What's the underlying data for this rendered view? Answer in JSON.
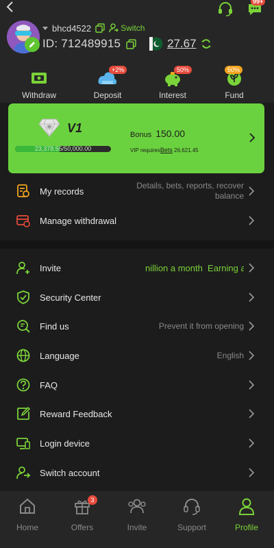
{
  "header": {
    "username": "bhcd4522",
    "switch_label": "Switch",
    "id_label": "ID: 712489915",
    "balance": "27.67",
    "notification_badge": "99+"
  },
  "actions": [
    {
      "label": "Withdraw",
      "badge": ""
    },
    {
      "label": "Deposit",
      "badge": "+2%"
    },
    {
      "label": "Interest",
      "badge": "50%"
    },
    {
      "label": "Fund",
      "badge": "50%"
    }
  ],
  "vip": {
    "level": "V1",
    "bonus_label": "Bonus",
    "bonus_value": "150.00",
    "progress_text": "23,378.55/50,000.00",
    "progress_fraction": 0.4676,
    "requires_label": "VIP requires",
    "requires_link": "Bets",
    "requires_value": "26,621.45"
  },
  "menu_top": [
    {
      "label": "My records",
      "value": "Details, bets, reports, recover balance"
    },
    {
      "label": "Manage withdrawal",
      "value": ""
    }
  ],
  "menu_bottom": [
    {
      "label": "Invite",
      "value": "nillion a month  Earning a"
    },
    {
      "label": "Security Center",
      "value": ""
    },
    {
      "label": "Find us",
      "value": "Prevent it from opening"
    },
    {
      "label": "Language",
      "value": "English"
    },
    {
      "label": "FAQ",
      "value": ""
    },
    {
      "label": "Reward Feedback",
      "value": ""
    },
    {
      "label": "Login device",
      "value": ""
    },
    {
      "label": "Switch account",
      "value": ""
    }
  ],
  "nav": [
    {
      "label": "Home",
      "badge": ""
    },
    {
      "label": "Offers",
      "badge": "3"
    },
    {
      "label": "Invite",
      "badge": ""
    },
    {
      "label": "Support",
      "badge": ""
    },
    {
      "label": "Profile",
      "badge": ""
    }
  ],
  "colors": {
    "accent": "#6bd23f",
    "badge": "#e64b3c",
    "background": "#1c1c1c"
  },
  "icons": [
    "back-icon",
    "headset-icon",
    "chat-icon",
    "copy-icon",
    "flag-icon",
    "refresh-icon",
    "withdraw-icon",
    "deposit-icon",
    "interest-icon",
    "fund-icon",
    "diamond-icon",
    "chevron-right-icon"
  ]
}
